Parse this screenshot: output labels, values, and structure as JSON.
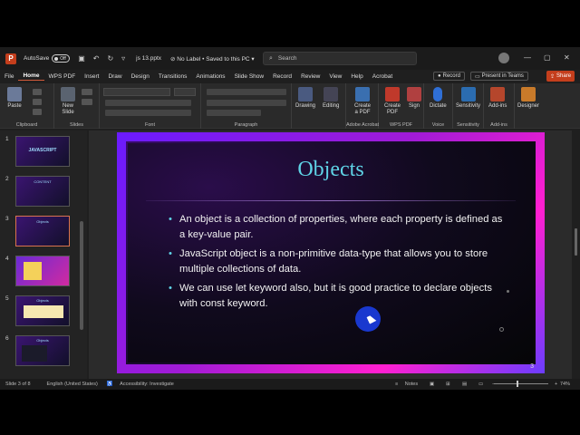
{
  "titlebar": {
    "autosave_label": "AutoSave",
    "autosave_state": "Off",
    "filename": "js 13.pptx",
    "sensitivity": "No Label",
    "saved_status": "Saved to this PC",
    "search_placeholder": "Search"
  },
  "menu": {
    "items": [
      "File",
      "Home",
      "WPS PDF",
      "Insert",
      "Draw",
      "Design",
      "Transitions",
      "Animations",
      "Slide Show",
      "Record",
      "Review",
      "View",
      "Help",
      "Acrobat"
    ],
    "active": "Home",
    "record_label": "Record",
    "present_label": "Present in Teams",
    "share_label": "Share"
  },
  "ribbon": {
    "clipboard": {
      "paste": "Paste",
      "group": "Clipboard"
    },
    "slides": {
      "new_slide": "New Slide",
      "group": "Slides"
    },
    "font_group": "Font",
    "paragraph_group": "Paragraph",
    "drawing": "Drawing",
    "editing": "Editing",
    "create_pdf": "Create a PDF",
    "adobe_group": "Adobe Acrobat",
    "wps_create_pdf": "Create PDF",
    "sign": "Sign",
    "wps_group": "WPS PDF",
    "dictate": "Dictate",
    "voice_group": "Voice",
    "sensitivity": "Sensitivity",
    "sensitivity_group": "Sensitivity",
    "addins": "Add-ins",
    "addins_group": "Add-ins",
    "designer": "Designer"
  },
  "thumbnails": [
    {
      "num": "1",
      "caption": "JAVASCRIPT"
    },
    {
      "num": "2",
      "caption": "CONTENT"
    },
    {
      "num": "3",
      "caption": "Objects"
    },
    {
      "num": "4",
      "caption": ""
    },
    {
      "num": "5",
      "caption": "Objects"
    },
    {
      "num": "6",
      "caption": "Objects"
    }
  ],
  "slide": {
    "title": "Objects",
    "bullets": [
      "An object is a collection of properties, where each property is defined as a key-value pair.",
      "JavaScript object is a non-primitive data-type that allows you to store multiple collections of data.",
      "We can use let keyword also, but it is good practice to declare objects with const keyword."
    ],
    "page_number": "3"
  },
  "status": {
    "slide_info": "Slide 3 of 8",
    "language": "English (United States)",
    "accessibility": "Accessibility: Investigate",
    "notes": "Notes",
    "zoom": "74%"
  },
  "colors": {
    "accent": "#c43e1c",
    "title_color": "#5fd3e6",
    "frame_start": "#6a1bff",
    "frame_end": "#ff1fd0"
  }
}
